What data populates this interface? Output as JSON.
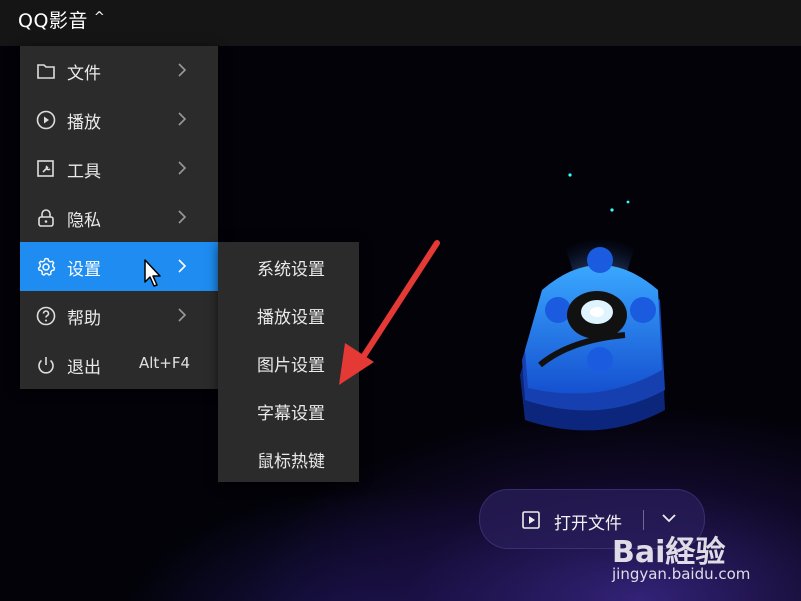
{
  "app": {
    "title": "QQ影音"
  },
  "menu": {
    "items": [
      {
        "label": "文件",
        "icon": "folder-icon",
        "has_submenu": true
      },
      {
        "label": "播放",
        "icon": "play-circle-icon",
        "has_submenu": true
      },
      {
        "label": "工具",
        "icon": "tool-icon",
        "has_submenu": true
      },
      {
        "label": "隐私",
        "icon": "lock-icon",
        "has_submenu": true
      },
      {
        "label": "设置",
        "icon": "gear-icon",
        "has_submenu": true,
        "active": true
      },
      {
        "label": "帮助",
        "icon": "help-icon",
        "has_submenu": true
      },
      {
        "label": "退出",
        "icon": "power-icon",
        "shortcut": "Alt+F4"
      }
    ]
  },
  "settings_submenu": {
    "items": [
      {
        "label": "系统设置"
      },
      {
        "label": "播放设置"
      },
      {
        "label": "图片设置"
      },
      {
        "label": "字幕设置"
      },
      {
        "label": "鼠标热键"
      }
    ]
  },
  "open_file": {
    "label": "打开文件"
  },
  "watermark": {
    "brand": "Bai経验",
    "url": "jingyan.baidu.com"
  },
  "colors": {
    "accent": "#1e8cf0",
    "menu_bg": "#2b2b2b",
    "annotation_red": "#e53935"
  }
}
